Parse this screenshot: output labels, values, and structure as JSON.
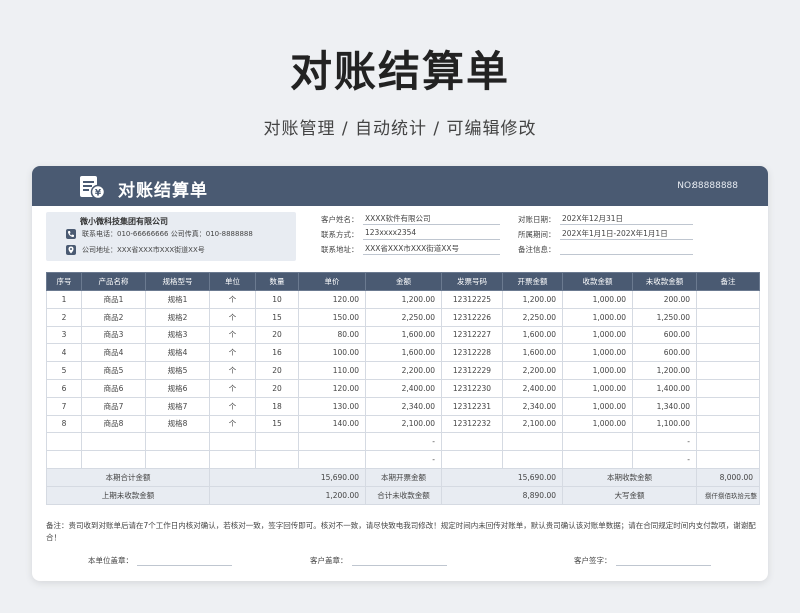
{
  "hero": {
    "title": "对账结算单",
    "subtitle": "对账管理 /  自动统计  /  可编辑修改"
  },
  "card": {
    "title": "对账结算单",
    "no_label": "NO:",
    "no_value": "88888888",
    "icon": "receipt-yen-icon"
  },
  "supplier": {
    "name": "微小微科技集团有限公司",
    "contact": "联系电话：010-66666666   公司传真：010-8888888",
    "address": "公司地址：XXX省XXX市XXX街道XX号"
  },
  "customer": {
    "name_label": "客户姓名：",
    "name_value": "XXXX软件有限公司",
    "contact_label": "联系方式：",
    "contact_value": "123xxxx2354",
    "address_label": "联系地址：",
    "address_value": "XXX省XXX市XXX街道XX号"
  },
  "period": {
    "date_label": "对账日期：",
    "date_value": "202X年12月31日",
    "range_label": "所属期间：",
    "range_value": "202X年1月1日-202X年1月1日",
    "remark_label": "备注信息：",
    "remark_value": ""
  },
  "table": {
    "headers": [
      "序号",
      "产品名称",
      "规格型号",
      "单位",
      "数量",
      "单价",
      "金额",
      "发票号码",
      "开票金额",
      "收款金额",
      "未收款金额",
      "备注"
    ],
    "rows": [
      [
        "1",
        "商品1",
        "规格1",
        "个",
        "10",
        "120.00",
        "1,200.00",
        "12312225",
        "1,200.00",
        "1,000.00",
        "200.00",
        ""
      ],
      [
        "2",
        "商品2",
        "规格2",
        "个",
        "15",
        "150.00",
        "2,250.00",
        "12312226",
        "2,250.00",
        "1,000.00",
        "1,250.00",
        ""
      ],
      [
        "3",
        "商品3",
        "规格3",
        "个",
        "20",
        "80.00",
        "1,600.00",
        "12312227",
        "1,600.00",
        "1,000.00",
        "600.00",
        ""
      ],
      [
        "4",
        "商品4",
        "规格4",
        "个",
        "16",
        "100.00",
        "1,600.00",
        "12312228",
        "1,600.00",
        "1,000.00",
        "600.00",
        ""
      ],
      [
        "5",
        "商品5",
        "规格5",
        "个",
        "20",
        "110.00",
        "2,200.00",
        "12312229",
        "2,200.00",
        "1,000.00",
        "1,200.00",
        ""
      ],
      [
        "6",
        "商品6",
        "规格6",
        "个",
        "20",
        "120.00",
        "2,400.00",
        "12312230",
        "2,400.00",
        "1,000.00",
        "1,400.00",
        ""
      ],
      [
        "7",
        "商品7",
        "规格7",
        "个",
        "18",
        "130.00",
        "2,340.00",
        "12312231",
        "2,340.00",
        "1,000.00",
        "1,340.00",
        ""
      ],
      [
        "8",
        "商品8",
        "规格8",
        "个",
        "15",
        "140.00",
        "2,100.00",
        "12312232",
        "2,100.00",
        "1,000.00",
        "1,100.00",
        ""
      ],
      [
        "",
        "",
        "",
        "",
        "",
        "",
        "-",
        "",
        "",
        "",
        "-",
        ""
      ],
      [
        "",
        "",
        "",
        "",
        "",
        "",
        "-",
        "",
        "",
        "",
        "-",
        ""
      ]
    ],
    "summary1": {
      "label1": "本期合计金额",
      "value1": "15,690.00",
      "label2": "本期开票金额",
      "value2": "15,690.00",
      "label3": "本期收款金额",
      "value3": "8,000.00"
    },
    "summary2": {
      "label1": "上期未收款金额",
      "value1": "1,200.00",
      "label2": "合计未收款金额",
      "value2": "8,890.00",
      "label3": "大写金额",
      "value3": "捌仟捌佰玖拾元整"
    }
  },
  "note": "备注：贵司收到对账单后请在7个工作日内核对确认，若核对一致，签字回传即可。核对不一致，请尽快致电我司修改！规定时间内未回传对账单，默认贵司确认该对账单数据；请在合同规定时间内支付款项，谢谢配合！",
  "signatures": {
    "seal_label": "本单位盖章：",
    "customer_seal_label": "客户盖章：",
    "customer_sign_label": "客户签字："
  },
  "colors": {
    "header": "#4a5a72",
    "summary_bg": "#e8ecf2"
  }
}
